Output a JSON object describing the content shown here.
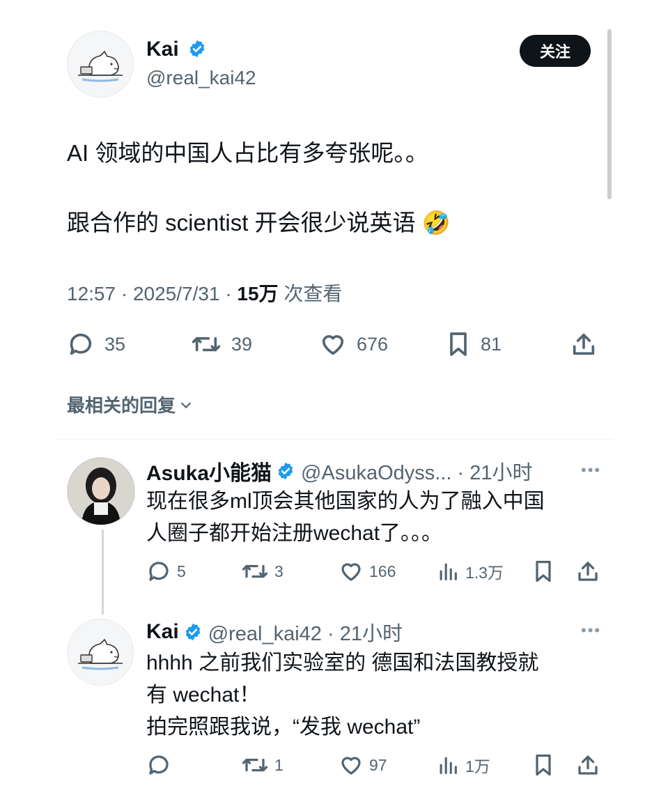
{
  "tweet": {
    "author": {
      "name": "Kai",
      "handle": "@real_kai42"
    },
    "follow_label": "关注",
    "text_line1": "AI 领域的中国人占比有多夸张呢。。",
    "text_line2": "跟合作的 scientist 开会很少说英语",
    "emoji": "🤣",
    "time": "12:57 · 2025/7/31 · ",
    "views_count": "15万",
    "views_label": " 次查看",
    "stats": {
      "replies": "35",
      "retweets": "39",
      "likes": "676",
      "bookmarks": "81"
    }
  },
  "replies_sort": {
    "label": "最相关的回复"
  },
  "replies": [
    {
      "name": "Asuka小能猫",
      "handle_time": "@AsukaOdyss... · 21小时",
      "text_lines": [
        "现在很多ml顶会其他国家的人为了融入中国",
        "人圈子都开始注册wechat了。。。"
      ],
      "stats": {
        "replies": "5",
        "retweets": "3",
        "likes": "166",
        "views": "1.3万"
      }
    },
    {
      "name": "Kai",
      "handle_time": "@real_kai42 · 21小时",
      "text_lines": [
        "hhhh 之前我们实验室的 德国和法国教授就",
        "有 wechat！",
        "拍完照跟我说，“发我 wechat”"
      ],
      "stats": {
        "replies": "",
        "retweets": "1",
        "likes": "97",
        "views": "1万"
      }
    }
  ],
  "colors": {
    "verified": "#1d9bf0",
    "text": "#0f1419",
    "muted": "#536471"
  }
}
